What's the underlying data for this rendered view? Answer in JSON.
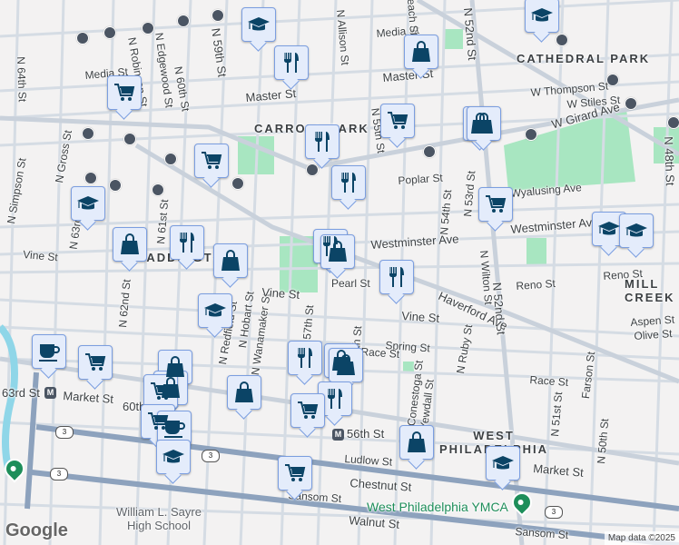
{
  "map": {
    "neighborhoods": [
      "CATHEDRAL PARK",
      "CARROLL PARK",
      "HADDINGTON",
      "WEST PHILADELPHIA",
      "MILL CREEK"
    ],
    "streets": [
      "N 64th St",
      "N 63rd St",
      "N 62nd St",
      "N 61st St",
      "N 60th St",
      "N 59th St",
      "N 57th St",
      "N 56th St",
      "N 55th St",
      "N 54th St",
      "N 53rd St",
      "N 52nd St",
      "N 51st St",
      "N 50th St",
      "N 48th St",
      "N Edgewood St",
      "N Robinson St",
      "N Gross St",
      "N Simpson St",
      "N Redfield St",
      "N Hobart St",
      "N Wanamaker St",
      "N Allison St",
      "N Wilton St",
      "N Ruby St",
      "Conestoga St",
      "Yewdall St",
      "Farson St",
      "Media St",
      "Master St",
      "W Thompson St",
      "W Stiles St",
      "W Girard Ave",
      "Poplar St",
      "Wyalusing Ave",
      "Westminster Ave",
      "Vine St",
      "Pearl St",
      "Haverford Ave",
      "Reno St",
      "Aspen St",
      "Olive St",
      "Spring St",
      "Race St",
      "Market St",
      "56th St",
      "60th St",
      "63rd St",
      "Ludlow St",
      "Chestnut St",
      "Sansom St",
      "Walnut St",
      "Peach St"
    ],
    "places": [
      "William L. Sayre High School",
      "West Philadelphia YMCA"
    ],
    "route_number": "3",
    "metro_label": "M",
    "google_logo": "Google",
    "attribution": "Map data ©2025"
  },
  "marker_types": {
    "grocery": "shopping-cart-icon",
    "shopping": "shopping-bag-icon",
    "restaurant": "fork-knife-icon",
    "school": "graduation-cap-icon",
    "cafe": "coffee-cup-icon"
  },
  "colors": {
    "marker_fill": "#e4ecfb",
    "marker_border": "#7b9ee0",
    "icon": "#0b4466",
    "park": "#a8e6c1",
    "highway": "#8da2bd",
    "poi": "#1e8e5a"
  }
}
